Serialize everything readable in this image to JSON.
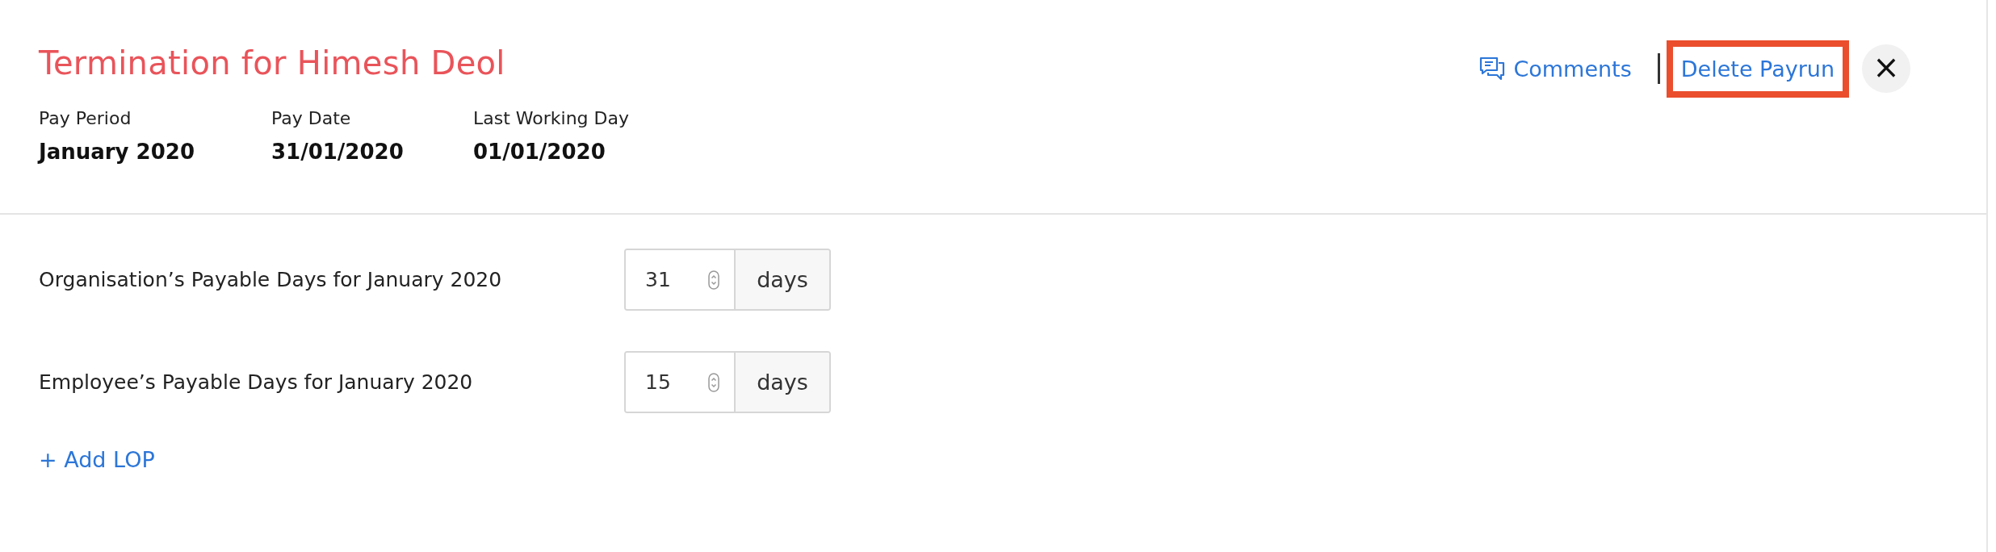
{
  "header": {
    "title": "Termination for Himesh Deol",
    "actions": [
      {
        "kind": "comments",
        "label": "Comments",
        "highlighted": false
      },
      {
        "kind": "delete",
        "label": "Delete Payrun",
        "highlighted": true
      },
      {
        "kind": "close",
        "label": "×",
        "highlighted": false
      }
    ],
    "summary": [
      {
        "label": "Pay Period",
        "value": "January 2020"
      },
      {
        "label": "Pay Date",
        "value": "31/01/2020"
      },
      {
        "label": "Last Working Day",
        "value": "01/01/2020"
      }
    ]
  },
  "fields": [
    {
      "label": "Organisation’s Payable Days for January 2020",
      "value": "31",
      "unit": "days"
    },
    {
      "label": "Employee’s Payable Days for January 2020",
      "value": "15",
      "unit": "days"
    }
  ],
  "add_link": "+ Add LOP"
}
